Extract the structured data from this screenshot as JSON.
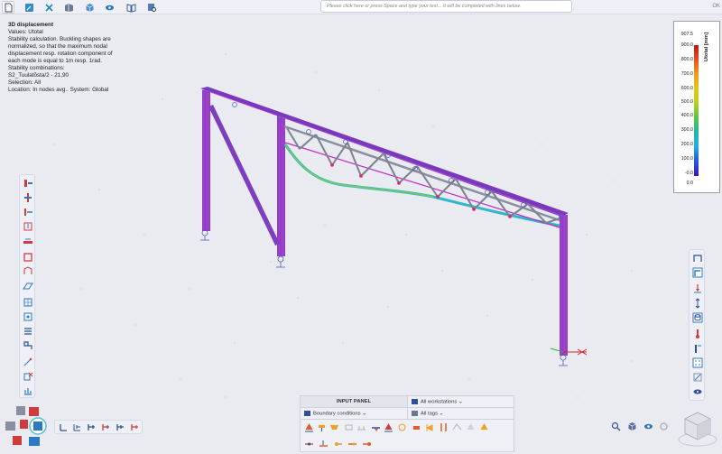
{
  "toolbar": {
    "icons": [
      "new-document-icon",
      "edit-icon",
      "tools-icon",
      "model-icon",
      "cube-icon",
      "eye-icon",
      "book-icon",
      "search-doc-icon"
    ],
    "command_placeholder": "Please click here or press Space and type your text... It will be completed with lines below.",
    "ok_label": "OK"
  },
  "info": {
    "title": "3D displacement",
    "values": "Values: Utotal",
    "description": "Stability calculation. Buckling shapes are normalized, so that the maximum nodal displacement resp. rotation component of each mode is equal to 1m resp. 1rad.",
    "stability_label": "Stability combinations:",
    "combination": "S2_Tuulatõsta/2 - 21,90",
    "selection": "Selection: All",
    "location": "Location: In nodes avg.. System: Global"
  },
  "legend": {
    "unit": "Utotal [mm]",
    "labels": [
      "907.5",
      "900.0",
      "800.0",
      "700.0",
      "600.0",
      "500.0",
      "400.0",
      "300.0",
      "200.0",
      "100.0",
      "-0.0",
      "0.0"
    ],
    "colors": [
      "#c01414",
      "#ee4b17",
      "#f19a1b",
      "#e2c619",
      "#b6d418",
      "#55c838",
      "#23b9a0",
      "#1ab4df",
      "#1e60e8",
      "#3a10c8"
    ]
  },
  "input_panel": {
    "title": "INPUT PANEL",
    "workstations": "All workstations",
    "boundary": "Boundary conditions",
    "tags": "All tags"
  },
  "left_tools": [
    "beam-icon",
    "column-icon",
    "support-icon",
    "load-icon",
    "slab-icon",
    "wall-icon",
    "section-icon",
    "plate-icon",
    "grid-icon",
    "node-icon",
    "dimension-icon",
    "connection-icon",
    "measure-icon",
    "delete-icon",
    "chart-icon"
  ],
  "right_tools": [
    "frame-icon",
    "pipe-icon",
    "point-load-icon",
    "dimension-arrow-icon",
    "layers-icon",
    "thermometer-icon",
    "column-select-icon",
    "grid-snap-icon",
    "clip-icon",
    "eye-view-icon"
  ],
  "nav": [
    "zoom-icon",
    "orbit-icon",
    "view-icon",
    "settings-icon"
  ]
}
